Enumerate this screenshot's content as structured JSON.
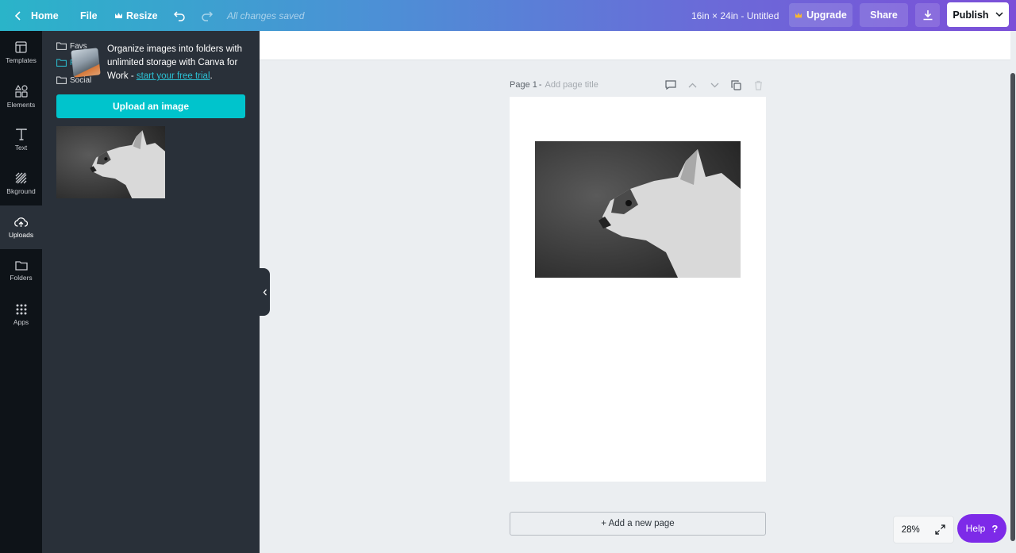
{
  "topbar": {
    "home_label": "Home",
    "file_label": "File",
    "resize_label": "Resize",
    "save_status": "All changes saved",
    "document_title": "16in × 24in - Untitled",
    "upgrade_label": "Upgrade",
    "share_label": "Share",
    "publish_label": "Publish"
  },
  "rail": {
    "items": [
      {
        "label": "Templates",
        "icon": "templates-icon"
      },
      {
        "label": "Elements",
        "icon": "elements-icon"
      },
      {
        "label": "Text",
        "icon": "text-icon"
      },
      {
        "label": "Bkground",
        "icon": "background-icon"
      },
      {
        "label": "Uploads",
        "icon": "uploads-icon",
        "active": true
      },
      {
        "label": "Folders",
        "icon": "folder-icon"
      },
      {
        "label": "Apps",
        "icon": "apps-icon"
      }
    ]
  },
  "panel": {
    "folders": [
      {
        "label": "Favs"
      },
      {
        "label": "Fa"
      },
      {
        "label": "Social"
      }
    ],
    "tip_text": "Organize images into folders with unlimited storage with Canva for Work - ",
    "tip_link": "start your free trial",
    "tip_end": ".",
    "upload_button": "Upload an image"
  },
  "canvas": {
    "page_label": "Page 1",
    "page_separator": "-",
    "page_title_placeholder": "Add page title",
    "add_page_label": "+ Add a new page",
    "zoom_level": "28%"
  },
  "help": {
    "label": "Help",
    "symbol": "?"
  },
  "colors": {
    "accent": "#00c4cc",
    "help": "#7d2ae8",
    "rail_bg": "#0e1318",
    "panel_bg": "#293039"
  }
}
